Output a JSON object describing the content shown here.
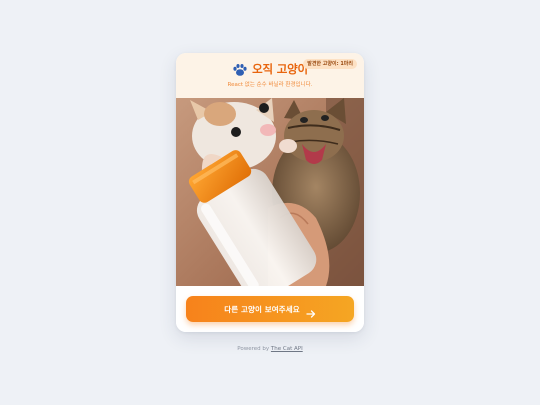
{
  "header": {
    "title": "오직 고양이",
    "subtitle": "React 없는 순수 바닐라 환경입니다.",
    "badge": "발견한 고양이: 1마리",
    "icon": "paw-icon"
  },
  "photo": {
    "alt": "Two kittens drinking from a milk bottle"
  },
  "action": {
    "next_label": "다른 고양이 보여주세요",
    "icon": "arrow-right-icon"
  },
  "footer": {
    "powered_prefix": "Powered by",
    "api_link": "The Cat API"
  },
  "colors": {
    "accent": "#f7821b",
    "accent_end": "#f5a623",
    "title": "#e8650e",
    "header_bg": "#fdf3e7",
    "page_bg": "#eef1f6"
  }
}
